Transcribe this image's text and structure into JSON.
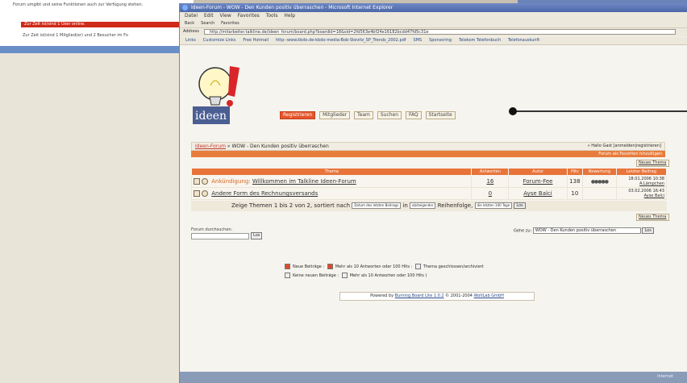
{
  "background_window": {
    "line1": "Forum umgibt und seine Funktionen auch zur Verfügung stehen.",
    "red_header": "Zur Zeit ist/sind 1 User online.",
    "line2": "Zur Zeit ist/sind 1 Mitglied(er) und 2 Besucher im Fo"
  },
  "window": {
    "title": "Ideen-Forum - WOW - Den Kunden positiv überraschen - Microsoft Internet Explorer",
    "menu": [
      "Datei",
      "Edit",
      "View",
      "Favorites",
      "Tools",
      "Help"
    ],
    "toolbar": [
      "Back",
      "Search",
      "Favorites"
    ],
    "address_label": "Address",
    "address_url": "http://mitarbeiter.talkline.de/ideen_forum/board.php?boardid=18&sid=2fd563e4bf24e16182bcdd47fd5c31e",
    "links_label": "Links",
    "links": [
      "Customize Links",
      "Free Hotmail",
      "http--www.kbdo.de-kbdo-media-Bob-Stevitz_SP_Trends_2002.pdf",
      "SMS",
      "Sponsoring",
      "Telekom Telefonbuch",
      "Telefonauskunft"
    ]
  },
  "logo": {
    "text": "ideen"
  },
  "nav": [
    "Registrieren",
    "Mitglieder",
    "Team",
    "Suchen",
    "FAQ",
    "Startseite"
  ],
  "breadcrumb": {
    "home": "Ideen-Forum",
    "current": "WOW - Den Kunden positiv überraschen"
  },
  "greeting": "» Hallo Gast [anmelden|registrieren]",
  "orange_bar_text": "Forum als Favoriten hinzufügen",
  "new_thread_label": "Neues Thema",
  "columns": [
    "Thema",
    "Antworten",
    "Autor",
    "Hits",
    "Bewertung",
    "Letzter Beitrag"
  ],
  "threads": [
    {
      "prefix": "Ankündigung:",
      "title": "Willkommen im Talkline Ideen-Forum",
      "replies": "16",
      "author": "Forum-Fee",
      "hits": "138",
      "rating": "●●●●●",
      "last_date": "18.01.2006 10:38",
      "last_by": "A.Lämpchen"
    },
    {
      "prefix": "",
      "title": "Andere Form des Rechnungsversands",
      "replies": "0",
      "author": "Ayse Balci",
      "hits": "10",
      "rating": "",
      "last_date": "03.02.2006 16:43",
      "last_by": "Ayse Balci"
    }
  ],
  "sort_row": {
    "text_a": "Zeige Themen 1 bis 2 von 2, sortiert nach",
    "sort_field": "Datum des letzten Beitrags",
    "text_b": "in",
    "order": "absteigender",
    "text_c": "Reihenfolge,",
    "range": "die letzten 100 Tage",
    "go": "Los"
  },
  "search": {
    "label": "Forum durchsuchen:",
    "go": "Los"
  },
  "goto": {
    "label": "Gehe zu:",
    "value": "WOW - Den Kunden positiv überraschen",
    "go": "Los"
  },
  "legend": {
    "new_posts": "Neue Beiträge",
    "hot_new": "Mehr als 10 Antworten oder 100 Hits",
    "closed": "Thema geschlossen/archiviert",
    "no_new": "Keine neuen Beiträge",
    "hot_no_new": "Mehr als 10 Antworten oder 100 Hits"
  },
  "footer": {
    "prefix": "Powered by",
    "product": "Burning Board Lite 1.0.2",
    "copy": "© 2001-2004",
    "company": "WoltLab GmbH"
  },
  "status": {
    "zone": "Internet"
  }
}
